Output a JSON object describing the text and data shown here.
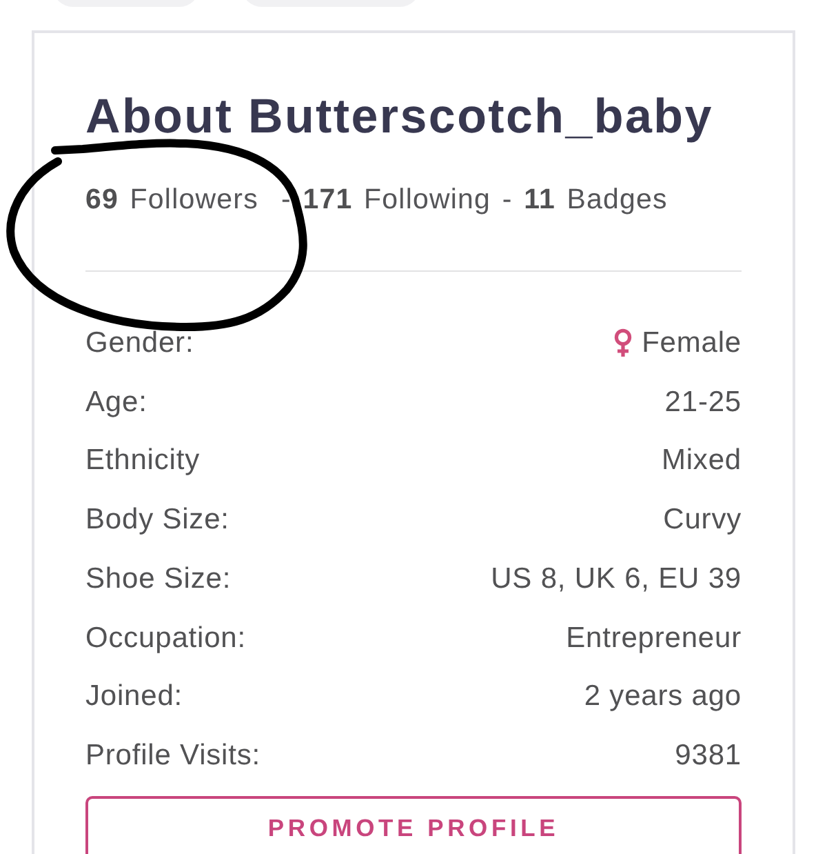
{
  "title": "About Butterscotch_baby",
  "stats": "**69** Followers  - **171** Following - **11** Badges",
  "details": [
    {
      "kind": "gender",
      "label": "Gender:",
      "value": "Female"
    },
    {
      "kind": "text",
      "label": "Age:",
      "value": "21-25"
    },
    {
      "kind": "text",
      "label": "Ethnicity",
      "value": "Mixed"
    },
    {
      "kind": "text",
      "label": "Body Size:",
      "value": "Curvy"
    },
    {
      "kind": "text",
      "label": "Shoe Size:",
      "value": "US 8, UK 6, EU 39"
    },
    {
      "kind": "text",
      "label": "Occupation:",
      "value": "Entrepreneur"
    },
    {
      "kind": "text",
      "label": "Joined:",
      "value": "2 years ago"
    },
    {
      "kind": "text",
      "label": "Profile Visits:",
      "value": "9381"
    }
  ],
  "promote_button": "PROMOTE PROFILE"
}
